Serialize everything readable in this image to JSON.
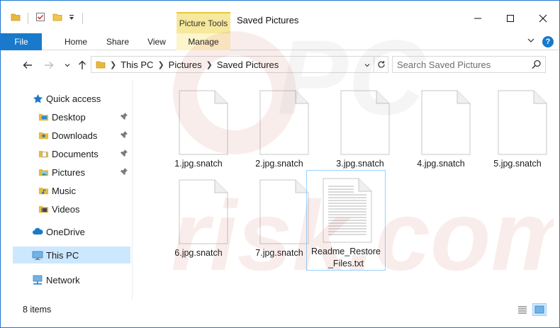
{
  "window": {
    "title": "Saved Pictures",
    "context_tab": "Picture Tools"
  },
  "ribbon": {
    "tabs": [
      {
        "label": "File"
      },
      {
        "label": "Home"
      },
      {
        "label": "Share"
      },
      {
        "label": "View"
      },
      {
        "label": "Manage"
      }
    ]
  },
  "address": {
    "crumbs": [
      "This PC",
      "Pictures",
      "Saved Pictures"
    ]
  },
  "search": {
    "placeholder": "Search Saved Pictures"
  },
  "navpane": {
    "quick_access": "Quick access",
    "items": [
      {
        "label": "Desktop",
        "icon": "desktop-icon",
        "pinned": true
      },
      {
        "label": "Downloads",
        "icon": "downloads-icon",
        "pinned": true
      },
      {
        "label": "Documents",
        "icon": "documents-icon",
        "pinned": true
      },
      {
        "label": "Pictures",
        "icon": "pictures-icon",
        "pinned": true
      },
      {
        "label": "Music",
        "icon": "music-icon",
        "pinned": false
      },
      {
        "label": "Videos",
        "icon": "videos-icon",
        "pinned": false
      }
    ],
    "onedrive": "OneDrive",
    "this_pc": "This PC",
    "network": "Network"
  },
  "files": [
    {
      "name": "1.jpg.snatch",
      "type": "blank"
    },
    {
      "name": "2.jpg.snatch",
      "type": "blank"
    },
    {
      "name": "3.jpg.snatch",
      "type": "blank"
    },
    {
      "name": "4.jpg.snatch",
      "type": "blank"
    },
    {
      "name": "5.jpg.snatch",
      "type": "blank"
    },
    {
      "name": "6.jpg.snatch",
      "type": "blank"
    },
    {
      "name": "7.jpg.snatch",
      "type": "blank"
    },
    {
      "name": "Readme_Restore_Files.txt",
      "type": "text"
    }
  ],
  "status": {
    "item_count": "8 items"
  },
  "watermark": "PC risk.com",
  "colors": {
    "accent": "#1979ca",
    "selection": "#cce8ff",
    "context_tab": "#f6e89c",
    "folder": "#e8b93c"
  }
}
